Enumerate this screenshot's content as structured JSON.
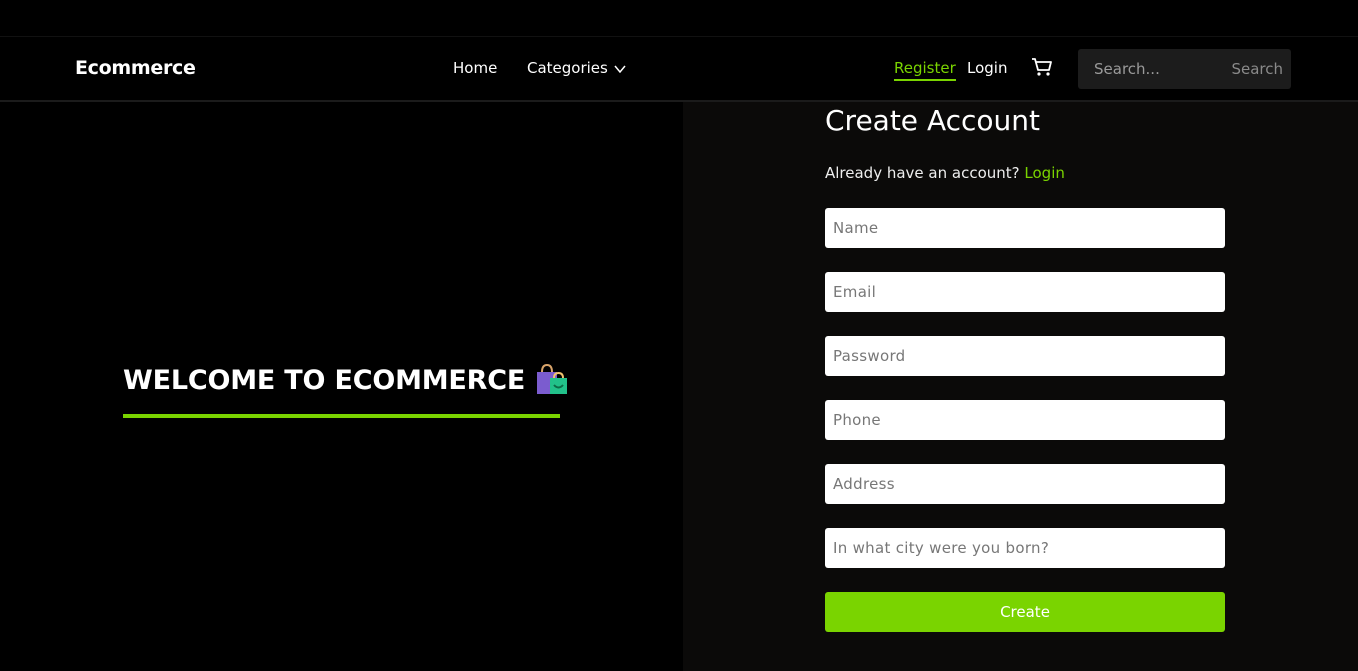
{
  "navbar": {
    "brand": "Ecommerce",
    "links": {
      "home": "Home",
      "categories": "Categories",
      "register": "Register",
      "login": "Login"
    },
    "search": {
      "placeholder": "Search...",
      "button": "Search"
    },
    "accent_color": "#7ad400"
  },
  "hero": {
    "welcome": "WELCOME TO ECOMMERCE"
  },
  "form": {
    "title": "Create Account",
    "already_text": "Already have an account?",
    "login_link": "Login",
    "fields": {
      "name": "Name",
      "email": "Email",
      "password": "Password",
      "phone": "Phone",
      "address": "Address",
      "security_question": "In what city were you born?"
    },
    "submit": "Create"
  }
}
